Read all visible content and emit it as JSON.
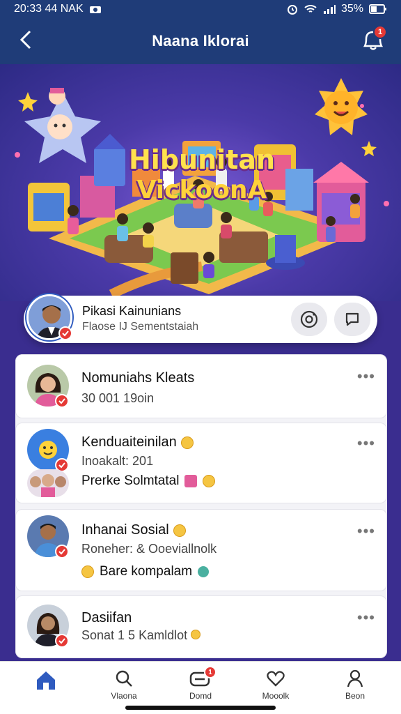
{
  "status_bar": {
    "time": "20:33 44 NAK",
    "battery": "35%"
  },
  "header": {
    "title": "Naana Iklorai",
    "notification_count": "1"
  },
  "hero": {
    "title_line1": "Hibunitan",
    "title_line2": "VickoonA"
  },
  "profile": {
    "name": "Pikasi Kainunians",
    "subtitle": "Flaose IJ Sementstaiah"
  },
  "posts": [
    {
      "title": "Nomuniahs Kleats",
      "subtitle": "30 001 19oin"
    },
    {
      "title": "Kenduaiteinilan",
      "subtitle": "Inoakalt: 201",
      "extra": "Prerke Solmtatal"
    },
    {
      "title": "Inhanai Sosial",
      "subtitle": "Roneher: & Ooeviallnolk",
      "extra": "Bare kompalam"
    },
    {
      "title": "Dasiifan",
      "subtitle": "Sonat 1 5 Kamldlot"
    }
  ],
  "nav": [
    {
      "label": "",
      "icon": "home-icon",
      "active": true
    },
    {
      "label": "Vlaona",
      "icon": "search-icon"
    },
    {
      "label": "Domd",
      "icon": "messages-icon",
      "badge": "1"
    },
    {
      "label": "Mooolk",
      "icon": "heart-icon"
    },
    {
      "label": "Beon",
      "icon": "profile-icon"
    }
  ],
  "colors": {
    "header": "#1f3c78",
    "accent": "#2f5bbf",
    "badge": "#e53935"
  }
}
